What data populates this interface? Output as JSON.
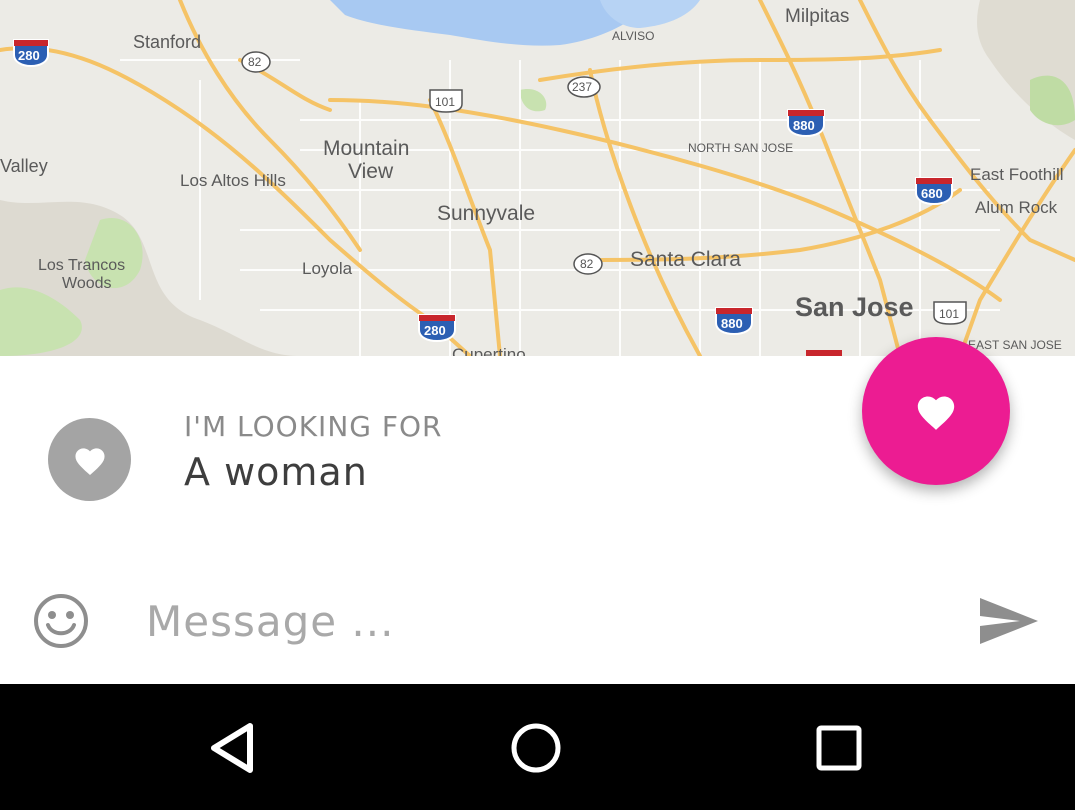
{
  "map": {
    "places": [
      "Milpitas",
      "Stanford",
      "ALVISO",
      "Mountain",
      "View",
      "NORTH SAN JOSE",
      "Valley",
      "Los Altos Hills",
      "East Foothill",
      "Alum Rock",
      "Sunnyvale",
      "Los Trancos",
      "Woods",
      "Loyola",
      "Santa Clara",
      "San Jose",
      "EAST SAN JOSE",
      "Cupertino"
    ],
    "shields": [
      "280",
      "82",
      "101",
      "237",
      "880",
      "680",
      "82",
      "280",
      "880",
      "101"
    ],
    "colors": {
      "water": "#a8c9f2",
      "road": "#f5c366",
      "park": "#c8e2b0",
      "land": "#ecebe6"
    }
  },
  "fab": {
    "icon": "heart-icon",
    "color": "#ec1c92"
  },
  "preference": {
    "icon": "heart-icon",
    "caption": "I'M LOOKING FOR",
    "value": "A woman"
  },
  "composer": {
    "emoji_icon": "smiley-icon",
    "placeholder": "Message ...",
    "value": "",
    "send_icon": "send-icon"
  },
  "navbar": {
    "back_icon": "back-triangle-icon",
    "home_icon": "home-circle-icon",
    "recents_icon": "recents-square-icon"
  }
}
